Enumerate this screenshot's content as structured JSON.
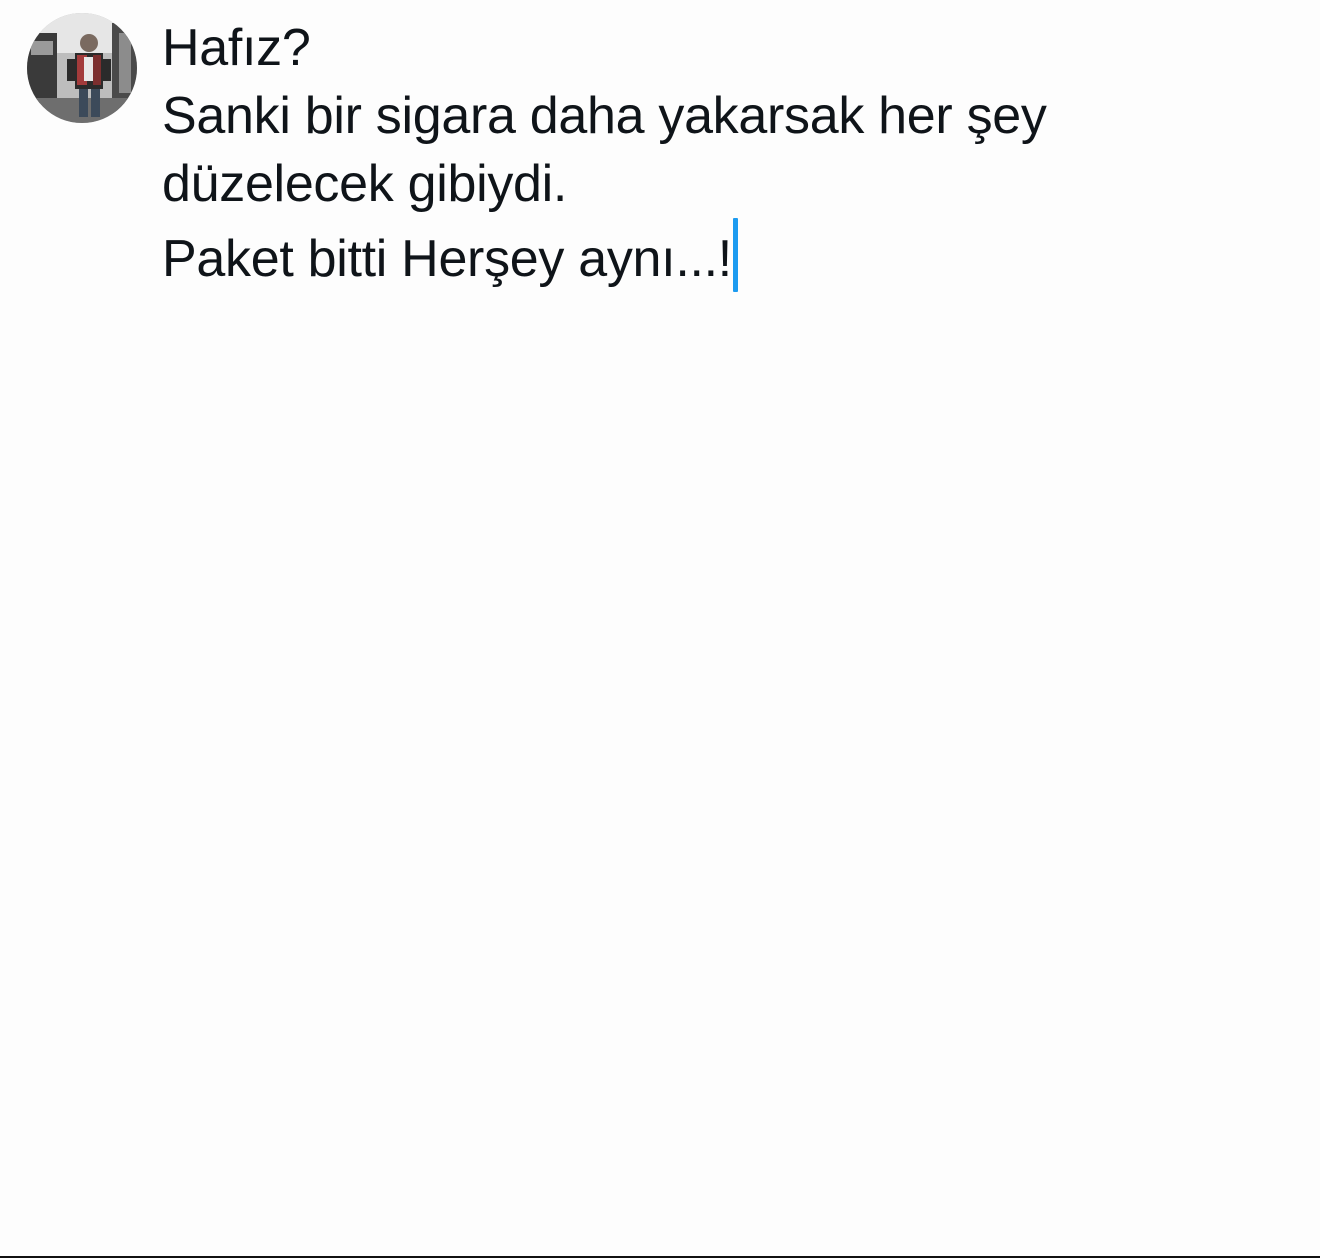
{
  "composer": {
    "lines": [
      "Hafız?",
      "Sanki bir sigara daha yakarsak her şey",
      "düzelecek gibiydi.",
      "Paket bitti Herşey aynı...!"
    ]
  },
  "colors": {
    "background": "#fdfdfd",
    "text": "#0f1419",
    "caret": "#1d9bf0"
  },
  "icons": {
    "avatar": "profile-photo"
  }
}
